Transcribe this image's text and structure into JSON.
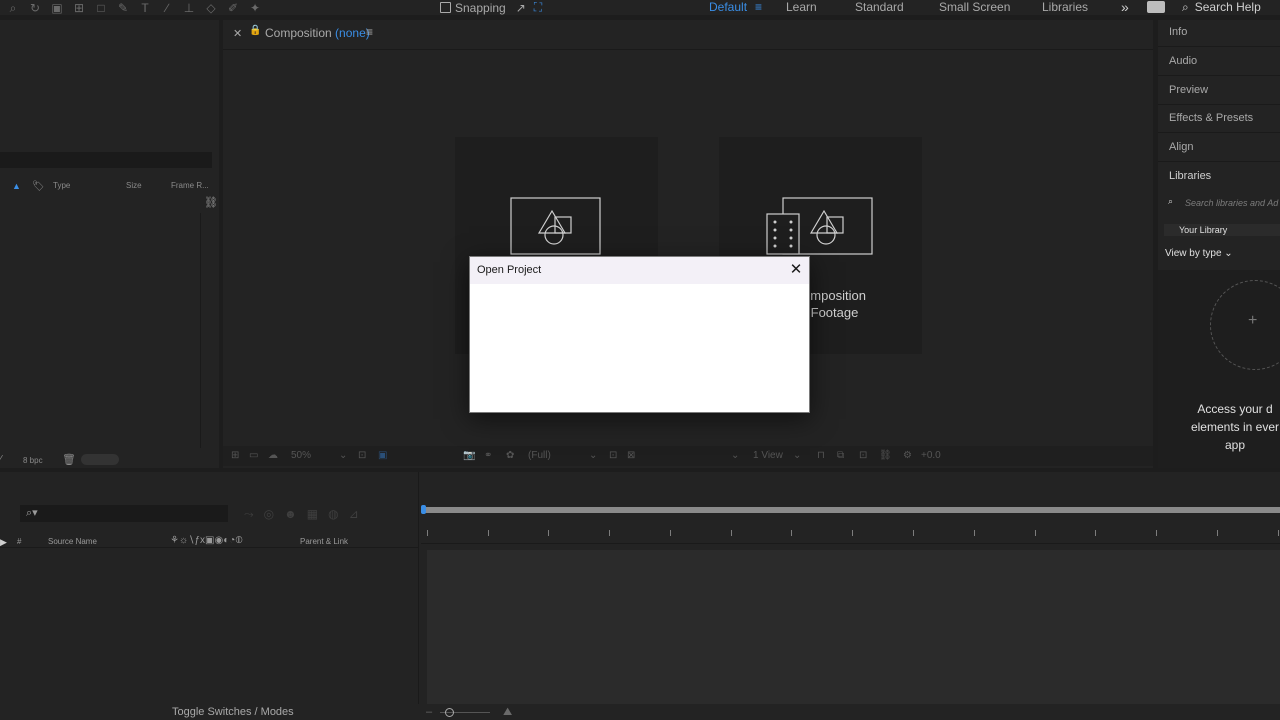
{
  "toolbar": {
    "snapping_label": "Snapping",
    "workspaces": {
      "default": "Default",
      "menu": "≡",
      "learn": "Learn",
      "standard": "Standard",
      "small_screen": "Small Screen",
      "libraries": "Libraries",
      "more": "»"
    },
    "search_help": "Search Help"
  },
  "project": {
    "columns": {
      "type": "Type",
      "size": "Size",
      "frame_rate": "Frame R..."
    },
    "bpc": "8 bpc"
  },
  "composition": {
    "title": "Composition",
    "title_value": "(none)",
    "card2_label_line1": "omposition",
    "card2_label_line2": "Footage",
    "bottom_zoom": "50%",
    "bottom_res": "(Full)",
    "bottom_view": "1 View",
    "bottom_offset": "+0.0"
  },
  "right_panel": {
    "items": [
      "Info",
      "Audio",
      "Preview",
      "Effects & Presets",
      "Align",
      "Libraries"
    ],
    "lib_search_placeholder": "Search libraries and Ad",
    "your_library": "Your Library",
    "view_by_type": "View by type",
    "access_line1": "Access your d",
    "access_line2": "elements in ever",
    "access_line3": "app"
  },
  "timeline": {
    "columns": {
      "num": "#",
      "source_name": "Source Name",
      "parent_link": "Parent & Link"
    },
    "toggle_label": "Toggle Switches / Modes"
  },
  "dialog": {
    "title": "Open Project"
  }
}
